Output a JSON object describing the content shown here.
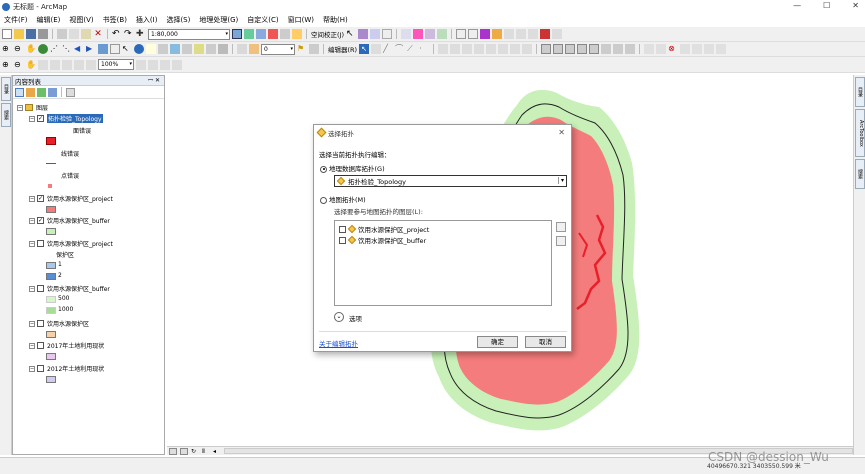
{
  "window": {
    "title": "无标题 - ArcMap"
  },
  "menu": [
    "文件(F)",
    "编辑(E)",
    "视图(V)",
    "书签(B)",
    "插入(I)",
    "选择(S)",
    "地理处理(G)",
    "自定义(C)",
    "窗口(W)",
    "帮助(H)"
  ],
  "toolbar": {
    "scale": "1:80,000",
    "spatial_adjust": "空间校正(J)",
    "georef_value": "0",
    "editor_label": "编辑器(R)",
    "zoom_percent": "100%"
  },
  "toc": {
    "title": "内容列表",
    "root": "图层",
    "layers": [
      {
        "name": "拓扑检验_Topology",
        "checked": true,
        "expanded": true,
        "selected": true,
        "legend": [
          {
            "label": "面错误"
          },
          {
            "label": "线错误"
          },
          {
            "label": "点错误"
          }
        ]
      },
      {
        "name": "饮用水源保护区_project",
        "checked": true
      },
      {
        "name": "饮用水源保护区_buffer",
        "checked": true
      },
      {
        "name": "饮用水源保护区_project",
        "checked": false,
        "field": "保护区",
        "classes": [
          "1",
          "2"
        ]
      },
      {
        "name": "饮用水源保护区_buffer",
        "checked": false,
        "classes": [
          "500",
          "1000"
        ]
      },
      {
        "name": "饮用水源保护区",
        "checked": false
      },
      {
        "name": "2017年土地利用现状",
        "checked": false
      },
      {
        "name": "2012年土地利用现状",
        "checked": false
      }
    ]
  },
  "side_tabs_left": [
    "目录",
    "搜索"
  ],
  "side_tabs_right": [
    "目录",
    "ArcToolbox",
    "搜索"
  ],
  "dialog": {
    "title": "选择拓扑",
    "prompt": "选择当前拓扑执行编辑：",
    "option_geodatabase": "地理数据库拓扑(G)",
    "selected_topology": "拓扑检验_Topology",
    "option_map": "地图拓扑(M)",
    "map_prompt": "选择要参与地图拓扑的图层(L):",
    "list_items": [
      "饮用水源保护区_project",
      "饮用水源保护区_buffer"
    ],
    "options_label": "选项",
    "help_link": "关于编辑拓扑",
    "ok": "确定",
    "cancel": "取消"
  },
  "status": {
    "coordinates": "40496670.321  3403550.599 米"
  },
  "watermark": "CSDN @dession_Wu",
  "colors": {
    "error_red": "#e8202a",
    "polygon_fill": "#f47c7c",
    "buffer_green": "#c8f0b8",
    "selection_blue": "#2a6ab8"
  }
}
